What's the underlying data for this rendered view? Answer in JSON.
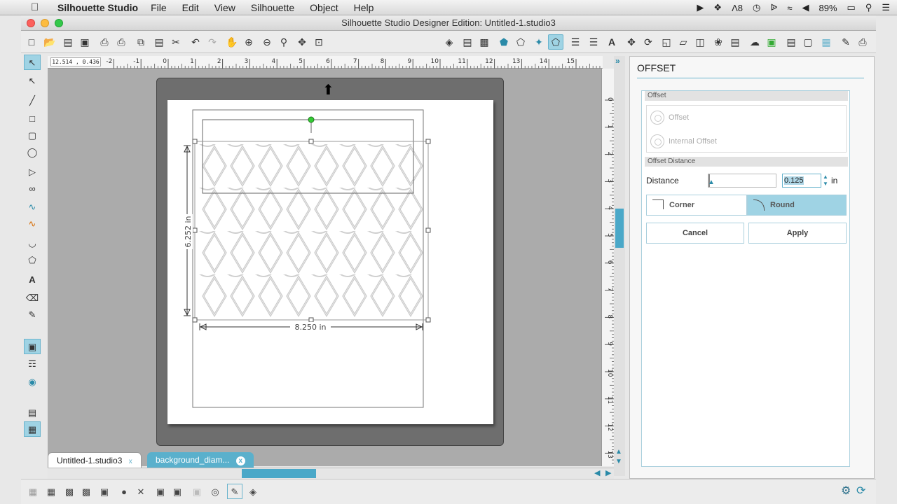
{
  "menubar": {
    "app_name": "Silhouette Studio",
    "menus": [
      "File",
      "Edit",
      "View",
      "Silhouette",
      "Object",
      "Help"
    ],
    "status_num": "8",
    "battery": "89%"
  },
  "window": {
    "title": "Silhouette Studio Designer Edition: Untitled-1.studio3"
  },
  "ruler": {
    "coord_readout": "12.514 , 0.436",
    "h_ticks": [
      "-2",
      "-1",
      "0",
      "1",
      "2",
      "3",
      "4",
      "5",
      "6",
      "7",
      "8",
      "9",
      "10",
      "11",
      "12",
      "13",
      "14",
      "15"
    ],
    "v_ticks": [
      "0",
      "1",
      "2",
      "3",
      "4",
      "5",
      "6",
      "7",
      "8",
      "9",
      "10",
      "11",
      "12",
      "13"
    ]
  },
  "design": {
    "height_label": "6.252 in",
    "width_label": "8.250 in"
  },
  "tabs": [
    {
      "label": "Untitled-1.studio3",
      "close": "x"
    },
    {
      "label": "background_diam...",
      "close": "x"
    }
  ],
  "offset_panel": {
    "title": "OFFSET",
    "section_offset": "Offset",
    "option_offset": "Offset",
    "option_internal": "Internal Offset",
    "section_distance": "Offset Distance",
    "distance_label": "Distance",
    "distance_value": "0.125",
    "distance_unit": "in",
    "corner_label": "Corner",
    "round_label": "Round",
    "cancel_label": "Cancel",
    "apply_label": "Apply"
  },
  "colors": {
    "accent": "#6ab4cd",
    "selected_bg": "#9fd3e4",
    "canvas": "#ababab"
  }
}
